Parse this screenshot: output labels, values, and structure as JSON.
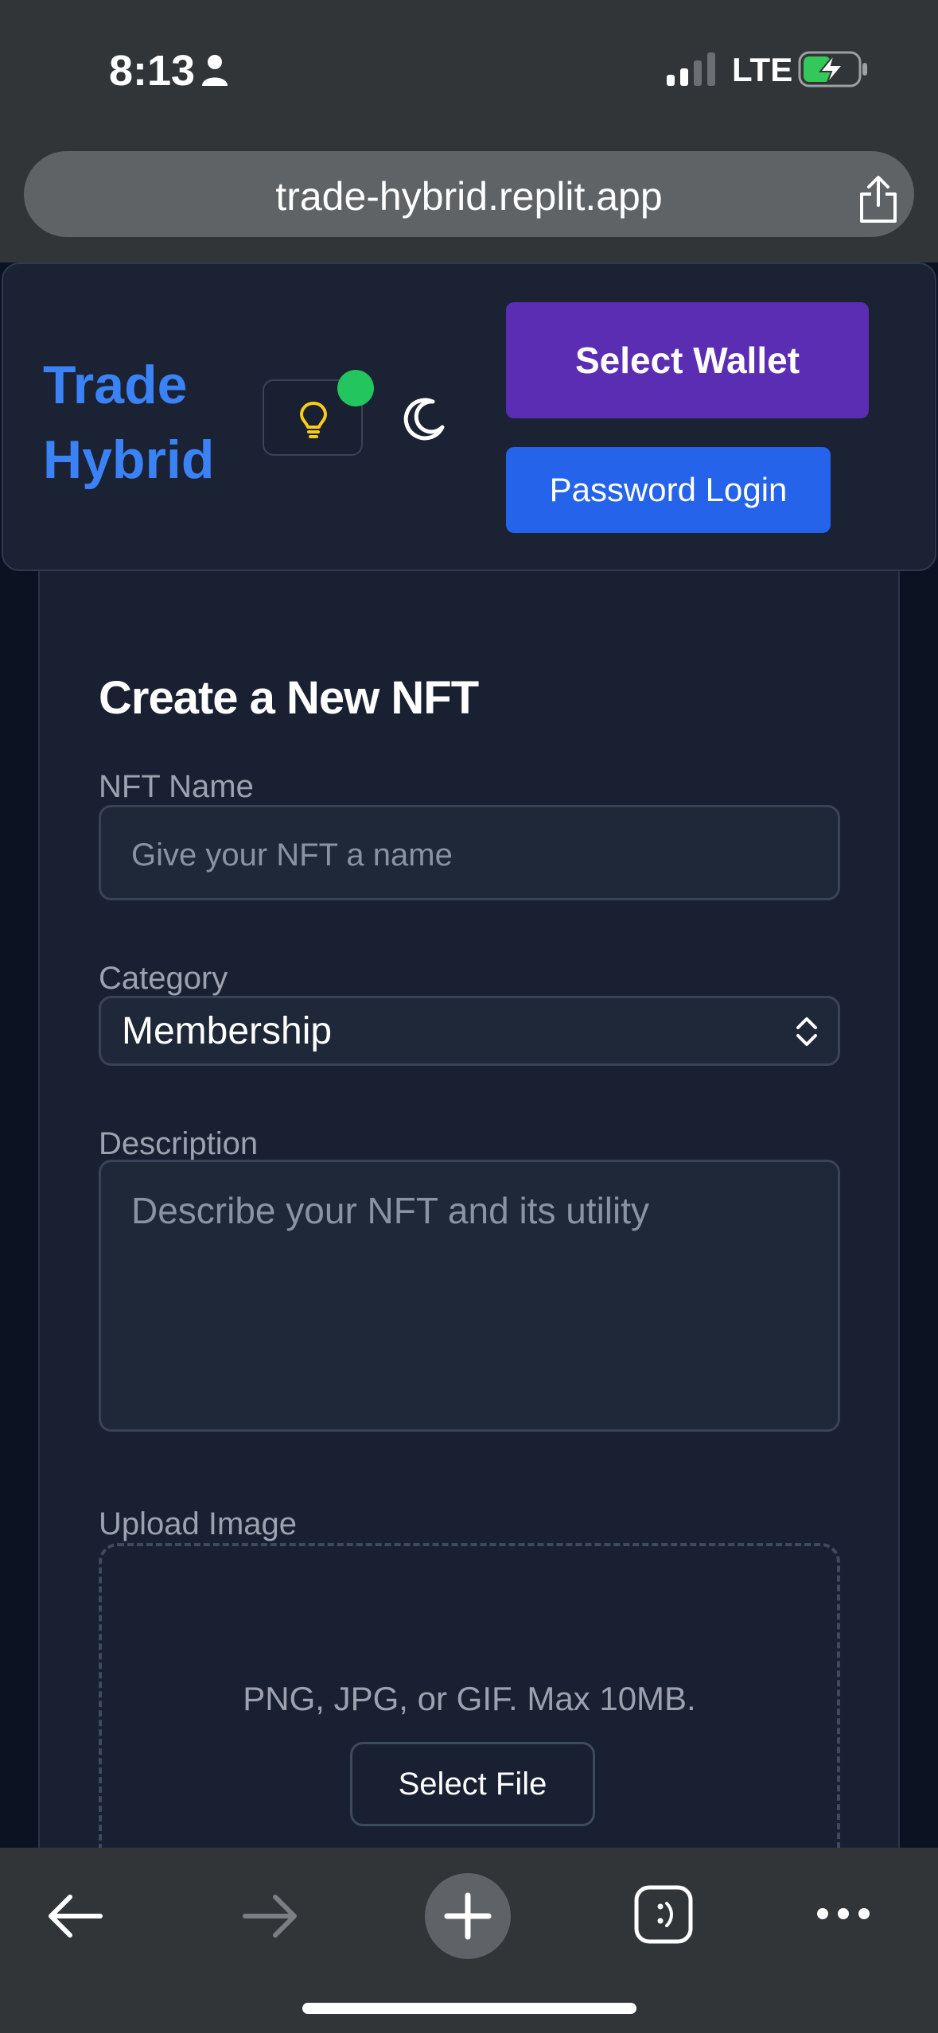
{
  "status_bar": {
    "time": "8:13",
    "network": "LTE"
  },
  "browser": {
    "url": "trade-hybrid.replit.app"
  },
  "header": {
    "logo": "Trade Hybrid",
    "select_wallet": "Select Wallet",
    "password_login": "Password Login"
  },
  "form": {
    "title": "Create a New NFT",
    "name_label": "NFT Name",
    "name_placeholder": "Give your NFT a name",
    "category_label": "Category",
    "category_value": "Membership",
    "description_label": "Description",
    "description_placeholder": "Describe your NFT and its utility",
    "upload_label": "Upload Image",
    "upload_hint": "PNG, JPG, or GIF. Max 10MB.",
    "select_file": "Select File"
  },
  "colors": {
    "brand": "#3b82f6",
    "wallet_button": "#5b2db3",
    "password_button": "#2563eb",
    "online_indicator": "#22c55e"
  }
}
